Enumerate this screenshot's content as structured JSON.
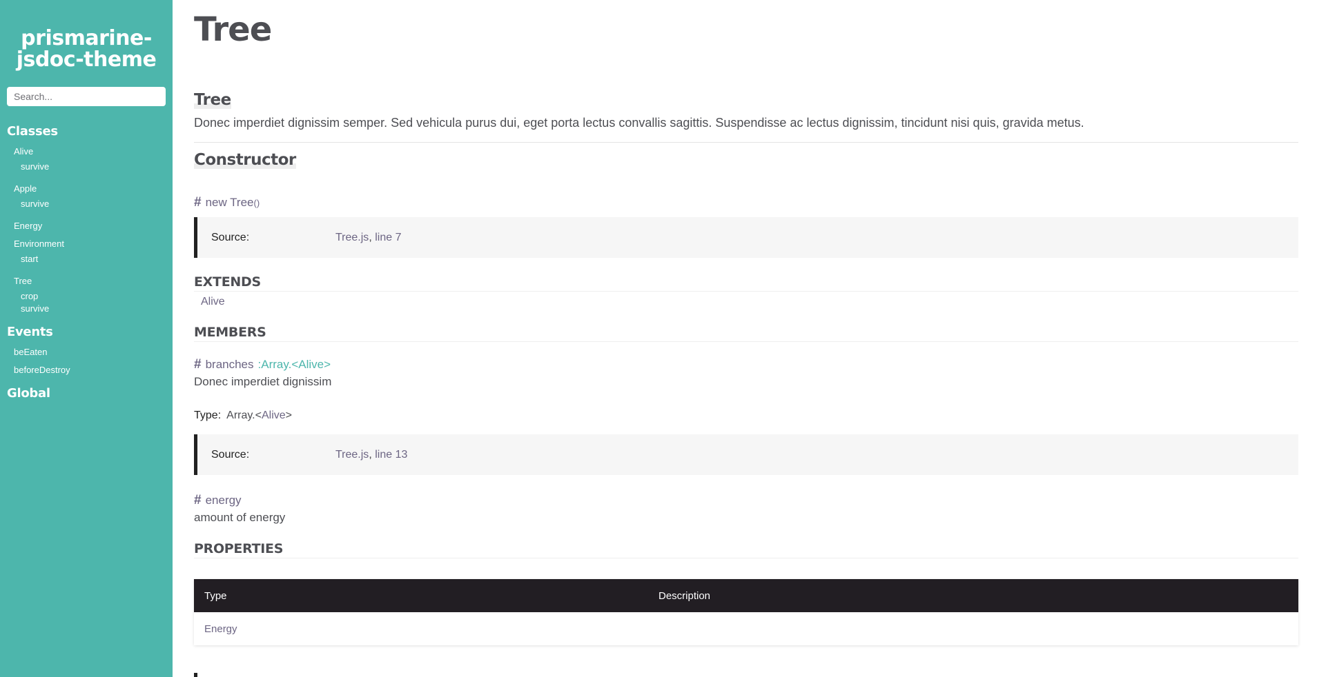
{
  "sidebar": {
    "brand_line1": "prismarine-",
    "brand_line2": "jsdoc-theme",
    "search_placeholder": "Search...",
    "classes_heading": "Classes",
    "classes": [
      {
        "name": "Alive",
        "members": [
          "survive"
        ]
      },
      {
        "name": "Apple",
        "members": [
          "survive"
        ]
      },
      {
        "name": "Energy",
        "members": []
      },
      {
        "name": "Environment",
        "members": [
          "start"
        ]
      },
      {
        "name": "Tree",
        "members": [
          "crop",
          "survive"
        ]
      }
    ],
    "events_heading": "Events",
    "events": [
      "beEaten",
      "beforeDestroy"
    ],
    "global_heading": "Global"
  },
  "main": {
    "page_title": "Tree",
    "class_title": "Tree",
    "class_description": "Donec imperdiet dignissim semper. Sed vehicula purus dui, eget porta lectus convallis sagittis. Suspendisse ac lectus dignissim, tincidunt nisi quis, gravida metus.",
    "constructor_heading": "Constructor",
    "constructor": {
      "hash": "#",
      "signature": "new Tree",
      "params": "()",
      "source_label": "Source:",
      "source_file": "Tree.js",
      "source_sep": ",",
      "source_line": "line 7"
    },
    "extends_heading": "EXTENDS",
    "extends": [
      "Alive"
    ],
    "members_heading": "MEMBERS",
    "members": [
      {
        "hash": "#",
        "name": "branches",
        "type_sig": ":Array.<Alive>",
        "description": "Donec imperdiet dignissim",
        "type_label": "Type:",
        "type_prefix": "Array.<",
        "type_link": "Alive",
        "type_suffix": ">",
        "source_label": "Source:",
        "source_file": "Tree.js",
        "source_sep": ",",
        "source_line": "line 13"
      },
      {
        "hash": "#",
        "name": "energy",
        "description": "amount of energy"
      }
    ],
    "properties_heading": "PROPERTIES",
    "properties_table": {
      "headers": [
        "Type",
        "Description"
      ],
      "rows": [
        [
          "Energy",
          ""
        ]
      ]
    }
  },
  "colors": {
    "sidebar_bg": "#4db6ac",
    "link": "#6c6583",
    "accent_type": "#4db6ac",
    "table_header_bg": "#221e23"
  }
}
